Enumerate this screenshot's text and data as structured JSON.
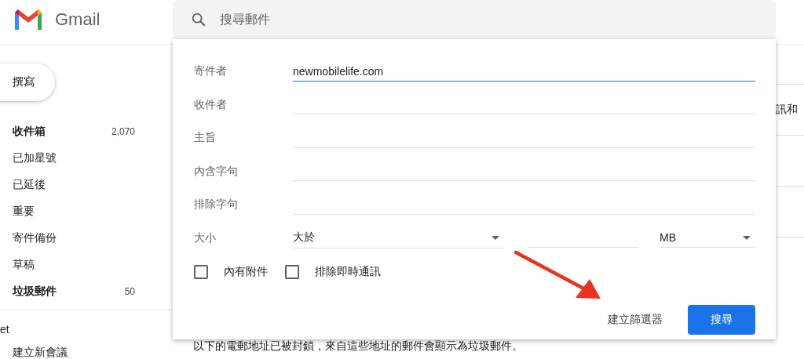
{
  "header": {
    "app_name": "Gmail"
  },
  "search": {
    "placeholder": "搜尋郵件"
  },
  "sidebar": {
    "compose": "撰寫",
    "items": [
      {
        "label": "收件箱",
        "count": "2,070",
        "bold": true
      },
      {
        "label": "已加星號",
        "bold": false
      },
      {
        "label": "已延後",
        "bold": false
      },
      {
        "label": "重要",
        "bold": false
      },
      {
        "label": "寄件備份",
        "bold": false
      },
      {
        "label": "草稿",
        "bold": false
      },
      {
        "label": "垃圾郵件",
        "count": "50",
        "bold": true
      }
    ],
    "section": "et",
    "section_items": [
      "建立新會議"
    ]
  },
  "main": {
    "partial_text": "訊和",
    "notice": "以下的電郵地址已被封鎖，來自這些地址的郵件會顯示為垃圾郵件。"
  },
  "filter_dialog": {
    "fields": [
      {
        "label": "寄件者",
        "value": "newmobilelife.com",
        "focused": true
      },
      {
        "label": "收件者",
        "focused": false
      },
      {
        "label": "主旨",
        "focused": false
      },
      {
        "label": "內含字句",
        "focused": false
      },
      {
        "label": "排除字句",
        "focused": false
      }
    ],
    "size": {
      "label": "大小",
      "comparison": "大於",
      "unit": "MB"
    },
    "checkboxes": [
      {
        "label": "內有附件",
        "checked": false
      },
      {
        "label": "排除即時通訊",
        "checked": false
      }
    ],
    "create_filter": "建立篩選器",
    "search_button": "搜尋"
  }
}
